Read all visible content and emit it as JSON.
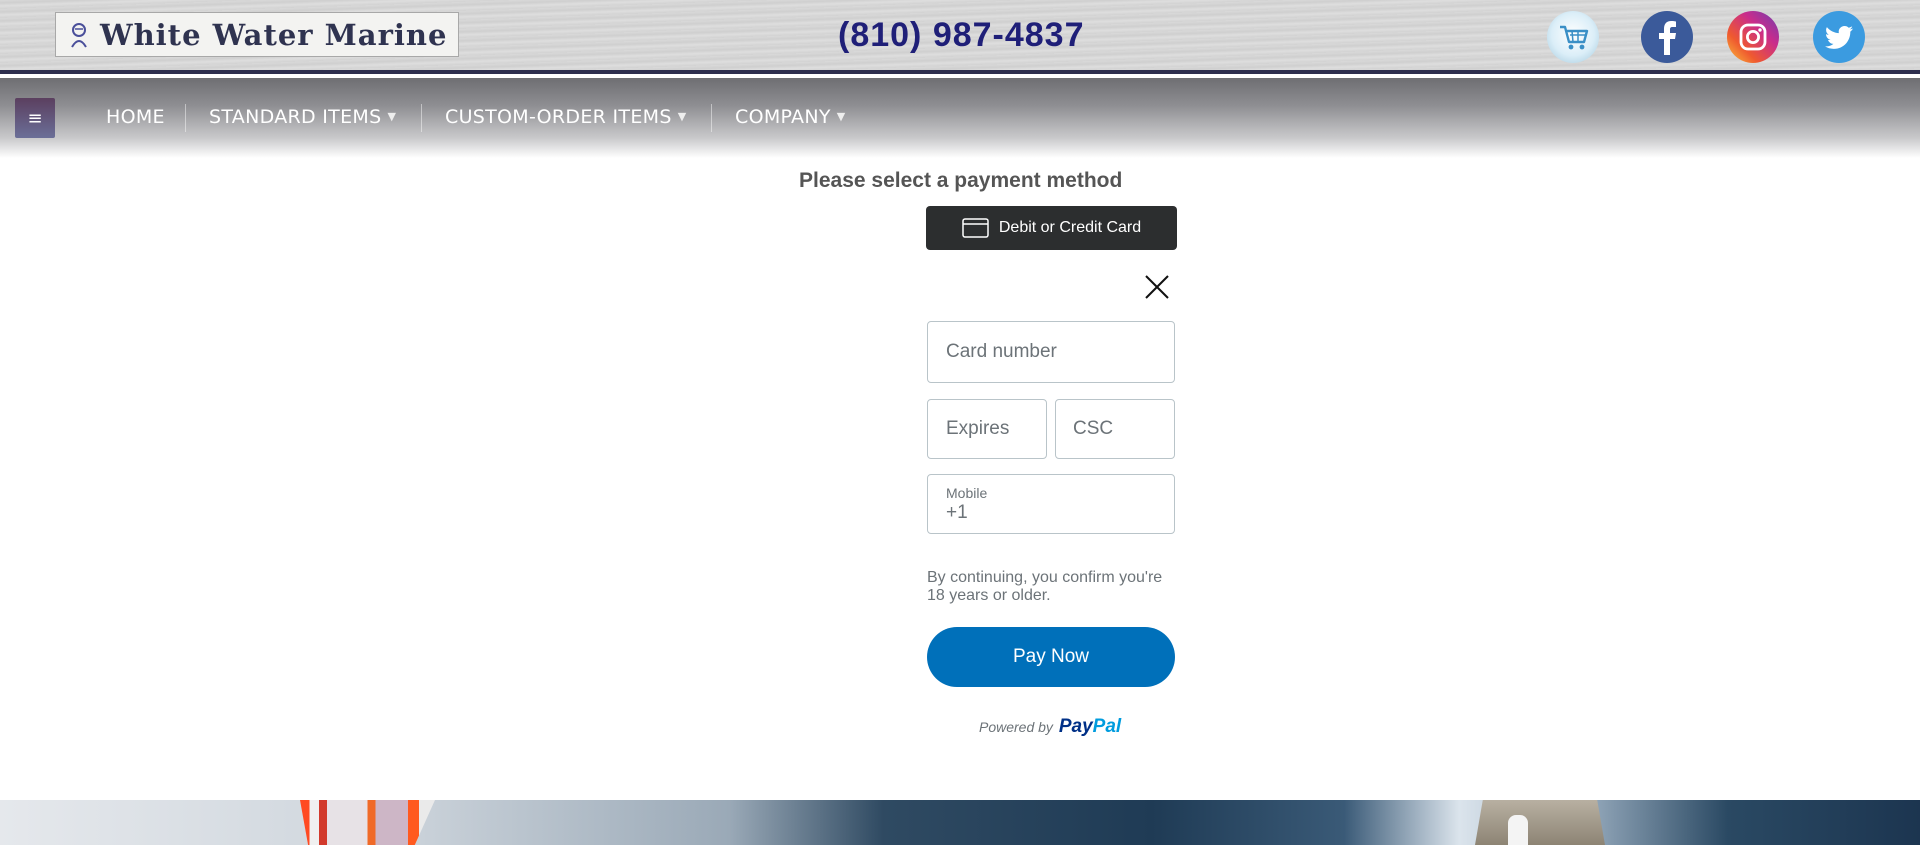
{
  "header": {
    "logo_text": "White Water Marine",
    "phone": "(810) 987-4837",
    "social": [
      {
        "name": "cart",
        "icon": "shopping-cart-icon"
      },
      {
        "name": "facebook",
        "icon": "facebook-icon"
      },
      {
        "name": "instagram",
        "icon": "instagram-icon"
      },
      {
        "name": "twitter",
        "icon": "twitter-icon"
      }
    ]
  },
  "nav": {
    "menu_icon": "≡",
    "items": [
      {
        "label": "HOME",
        "has_dropdown": false
      },
      {
        "label": "STANDARD ITEMS",
        "has_dropdown": true
      },
      {
        "label": "CUSTOM-ORDER ITEMS",
        "has_dropdown": true
      },
      {
        "label": "COMPANY",
        "has_dropdown": true
      }
    ],
    "caret": "▼"
  },
  "payment": {
    "heading": "Please select a payment method",
    "card_button_label": "Debit or Credit Card",
    "card_number_placeholder": "Card number",
    "expires_placeholder": "Expires",
    "csc_placeholder": "CSC",
    "mobile_label": "Mobile",
    "mobile_value": "+1",
    "disclaimer": "By continuing, you confirm you're 18 years or older.",
    "pay_now_label": "Pay Now",
    "powered_by": "Powered by",
    "paypal_part1": "Pay",
    "paypal_part2": "Pal"
  },
  "colors": {
    "header_border": "#2e2f4e",
    "phone": "#1f1f78",
    "card_button": "#2c2e2f",
    "pay_now": "#0070ba",
    "paypal_dark": "#003087",
    "paypal_light": "#009cde"
  }
}
